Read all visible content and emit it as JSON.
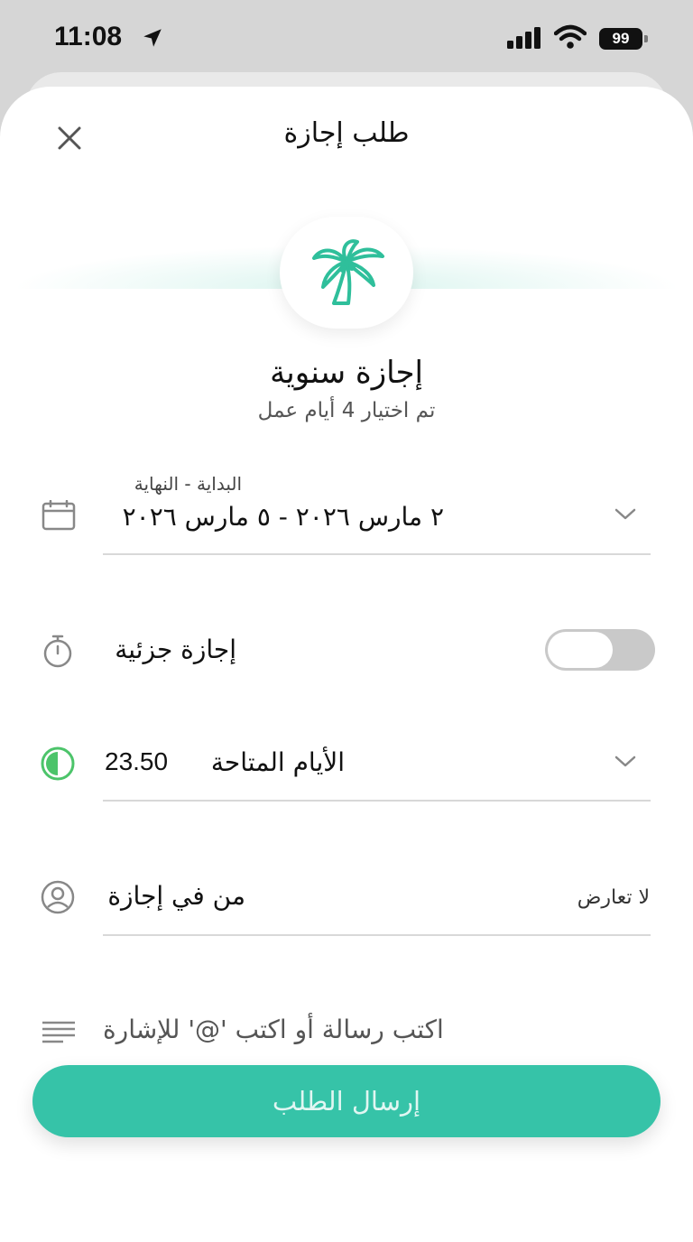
{
  "status_bar": {
    "time": "11:08",
    "battery": "99"
  },
  "header": {
    "title": "طلب إجازة"
  },
  "leave": {
    "name": "إجازة سنوية",
    "selected_days": "تم اختيار 4 أيام عمل"
  },
  "date_range": {
    "label": "البداية - النهاية",
    "value": "٢ مارس ٢٠٢٦ - ٥ مارس ٢٠٢٦"
  },
  "partial": {
    "label": "إجازة جزئية",
    "enabled": false
  },
  "available": {
    "label": "الأيام المتاحة",
    "value": "23.50"
  },
  "who_on_leave": {
    "label": "من في إجازة",
    "status": "لا تعارض"
  },
  "message": {
    "placeholder": "اكتب رسالة أو اكتب '@' للإشارة"
  },
  "submit": {
    "label": "إرسال الطلب"
  },
  "colors": {
    "accent": "#36c3a8",
    "available_icon": "#4cc46a"
  }
}
